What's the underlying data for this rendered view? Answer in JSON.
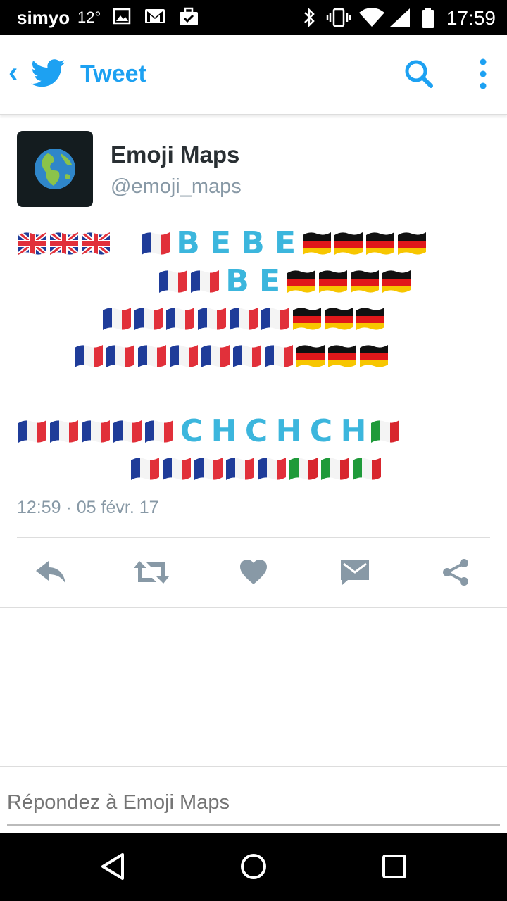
{
  "status_bar": {
    "carrier": "simyo",
    "temperature": "12°",
    "time": "17:59"
  },
  "header": {
    "back_label": "‹",
    "title": "Tweet"
  },
  "tweet": {
    "author_name": "Emoji Maps",
    "handle": "@emoji_maps",
    "timestamp": "12:59 · 05 févr. 17",
    "rows": [
      {
        "items": [
          "uk",
          "uk",
          "uk",
          " ",
          "fr",
          "B",
          "E",
          "B",
          "E",
          "de",
          "de",
          "de",
          "de"
        ]
      },
      {
        "items": [
          "fr",
          "fr",
          "B",
          "E",
          "de",
          "de",
          "de",
          "de"
        ]
      },
      {
        "items": [
          "fr",
          "fr",
          "fr",
          "fr",
          "fr",
          "fr",
          "de",
          "de",
          "de"
        ]
      },
      {
        "items": [
          "fr",
          "fr",
          "fr",
          "fr",
          "fr",
          "fr",
          "fr",
          "de",
          "de",
          "de"
        ]
      },
      {
        "items": [
          "fr",
          "fr",
          "fr",
          "fr",
          "fr",
          "C",
          "H",
          "C",
          "H",
          "C",
          "H",
          "it"
        ]
      },
      {
        "items": [
          "fr",
          "fr",
          "fr",
          "fr",
          "fr",
          "it",
          "it",
          "it"
        ]
      }
    ]
  },
  "actions": [
    "reply-icon",
    "retweet-icon",
    "like-icon",
    "message-icon",
    "share-icon"
  ],
  "reply": {
    "placeholder": "Répondez à Emoji Maps"
  },
  "colors": {
    "accent": "#1da1f2",
    "letters": "#3cb6dd",
    "icon_gray": "#8899a6"
  }
}
